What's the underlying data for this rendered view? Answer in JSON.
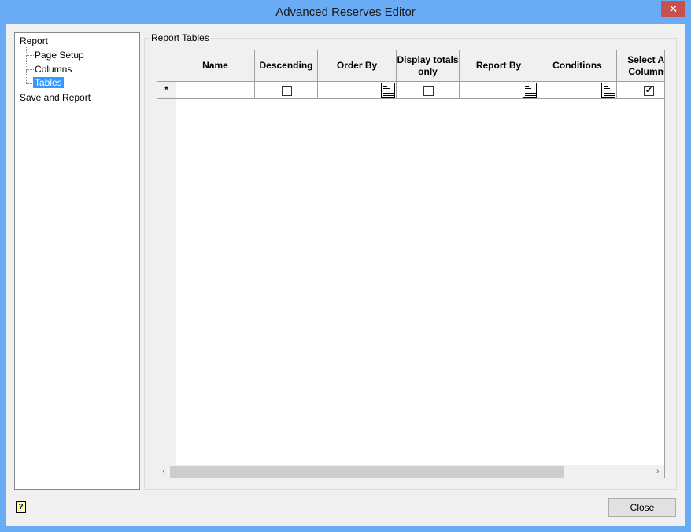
{
  "window": {
    "title": "Advanced Reserves Editor",
    "close_glyph": "✕"
  },
  "tree": {
    "root": "Report",
    "children": [
      "Page Setup",
      "Columns",
      "Tables"
    ],
    "selected": "Tables",
    "last": "Save and Report"
  },
  "group": {
    "title": "Report Tables"
  },
  "grid": {
    "columns": [
      {
        "label": "Name",
        "type": "text"
      },
      {
        "label": "Descending",
        "type": "checkbox",
        "checked": false
      },
      {
        "label": "Order By",
        "type": "editor"
      },
      {
        "label": "Display totals only",
        "type": "checkbox",
        "checked": false
      },
      {
        "label": "Report By",
        "type": "editor"
      },
      {
        "label": "Conditions",
        "type": "editor"
      },
      {
        "label": "Select All Columns",
        "type": "checkbox",
        "checked": true
      }
    ],
    "new_row_marker": "*",
    "scroll_left": "‹",
    "scroll_right": "›"
  },
  "footer": {
    "help_glyph": "?",
    "close_label": "Close"
  }
}
